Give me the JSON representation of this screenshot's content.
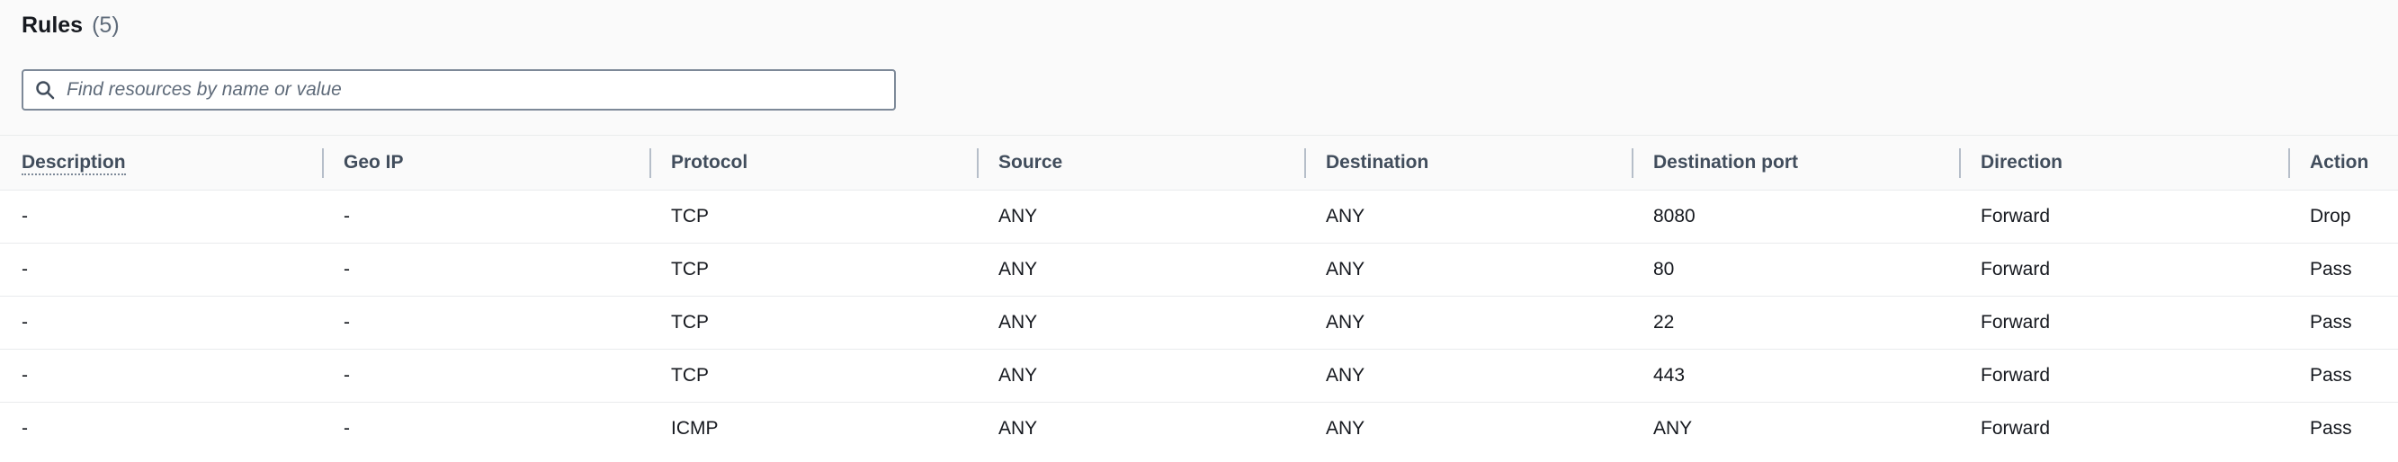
{
  "header": {
    "title": "Rules",
    "count": "(5)"
  },
  "search": {
    "placeholder": "Find resources by name or value",
    "value": ""
  },
  "table": {
    "columns": [
      "Description",
      "Geo IP",
      "Protocol",
      "Source",
      "Destination",
      "Destination port",
      "Direction",
      "Action"
    ],
    "rows": [
      [
        "-",
        "-",
        "TCP",
        "ANY",
        "ANY",
        "8080",
        "Forward",
        "Drop"
      ],
      [
        "-",
        "-",
        "TCP",
        "ANY",
        "ANY",
        "80",
        "Forward",
        "Pass"
      ],
      [
        "-",
        "-",
        "TCP",
        "ANY",
        "ANY",
        "22",
        "Forward",
        "Pass"
      ],
      [
        "-",
        "-",
        "TCP",
        "ANY",
        "ANY",
        "443",
        "Forward",
        "Pass"
      ],
      [
        "-",
        "-",
        "ICMP",
        "ANY",
        "ANY",
        "ANY",
        "Forward",
        "Pass"
      ]
    ]
  },
  "icons": {
    "search": "search-icon"
  },
  "colors": {
    "text": "#16191f",
    "muted": "#5f6b7a",
    "header_text": "#414d5c",
    "border": "#7d8998",
    "background": "#fafafa"
  }
}
